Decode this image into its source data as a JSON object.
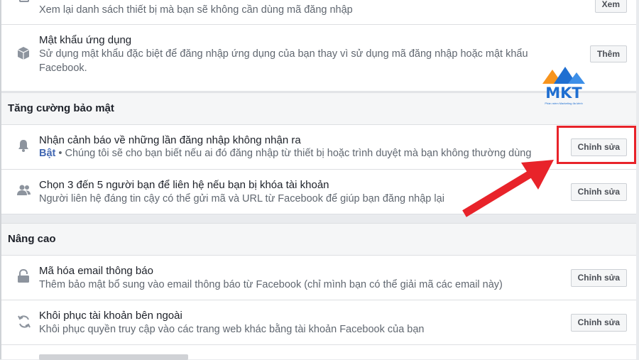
{
  "rows": {
    "view_previous": {
      "desc": "Xem lại danh sách thiết bị mà bạn sẽ không cần dùng mã đăng nhập",
      "button": "Xem"
    },
    "app_passwords": {
      "title": "Mật khẩu ứng dụng",
      "desc": "Sử dụng mật khẩu đặc biệt để đăng nhập ứng dụng của bạn thay vì sử dụng mã đăng nhập hoặc mật khẩu Facebook.",
      "button": "Thêm"
    },
    "login_alerts": {
      "title": "Nhận cảnh báo về những lần đăng nhập không nhận ra",
      "status": "Bật",
      "desc": " • Chúng tôi sẽ cho bạn biết nếu ai đó đăng nhập từ thiết bị hoặc trình duyệt mà bạn không thường dùng",
      "button": "Chỉnh sửa"
    },
    "trusted_contacts": {
      "title": "Chọn 3 đến 5 người bạn để liên hệ nếu bạn bị khóa tài khoản",
      "desc": "Người liên hệ đáng tin cậy có thể gửi mã và URL từ Facebook để giúp bạn đăng nhập lại",
      "button": "Chỉnh sửa"
    },
    "encrypted_email": {
      "title": "Mã hóa email thông báo",
      "desc": "Thêm bảo mật bổ sung vào email thông báo từ Facebook (chỉ mình bạn có thể giải mã các email này)",
      "button": "Chỉnh sửa"
    },
    "recover_external": {
      "title": "Khôi phục tài khoản bên ngoài",
      "desc": "Khôi phục quyền truy cập vào các trang web khác bằng tài khoản Facebook của bạn",
      "button": "Chỉnh sửa"
    }
  },
  "sections": {
    "security": "Tăng cường bảo mật",
    "advanced": "Nâng cao"
  },
  "logo": {
    "text": "MKT",
    "tagline": "Phần mềm Marketing đa kênh"
  },
  "colors": {
    "accent_blue": "#4267b2",
    "highlight_red": "#e8232a",
    "logo_blue": "#1f6fd1",
    "logo_orange": "#f7941d"
  }
}
